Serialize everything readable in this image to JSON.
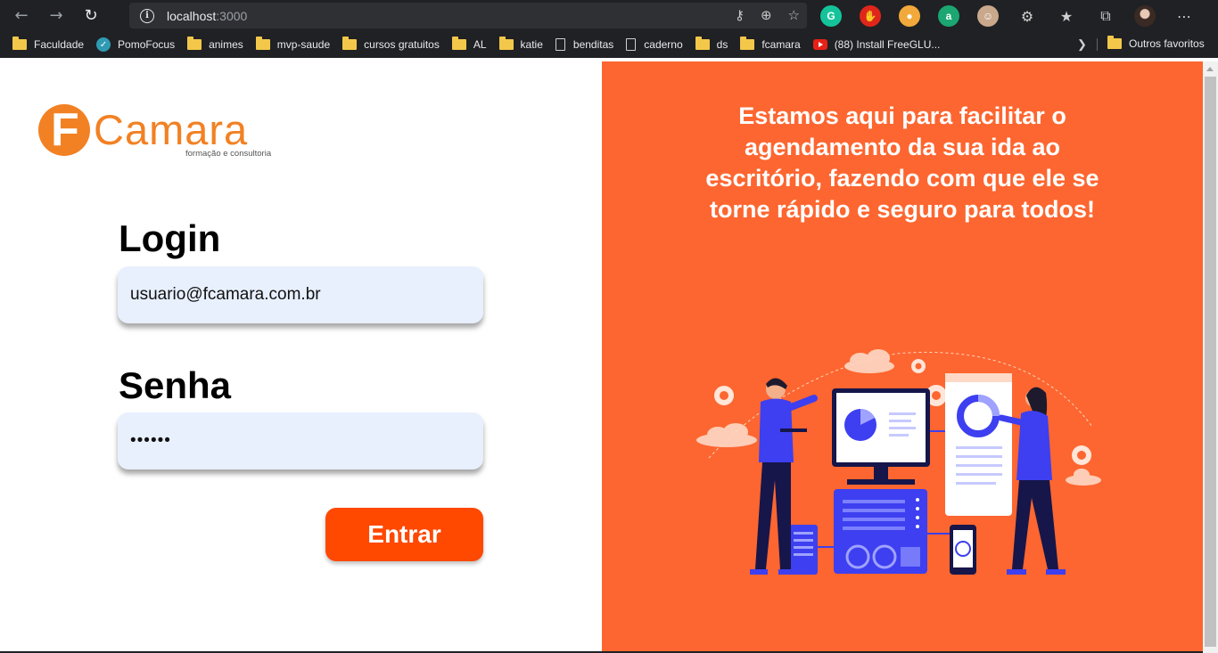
{
  "browser": {
    "url_host": "localhost",
    "url_port": ":3000",
    "extensions": [
      "grammarly-icon",
      "adblock-icon",
      "extension-icon",
      "extension-a-icon",
      "profile-extension-icon"
    ],
    "bookmarks": [
      {
        "label": "Faculdade",
        "icon": "folder"
      },
      {
        "label": "PomoFocus",
        "icon": "check"
      },
      {
        "label": "animes",
        "icon": "folder"
      },
      {
        "label": "mvp-saude",
        "icon": "folder"
      },
      {
        "label": "cursos gratuitos",
        "icon": "folder"
      },
      {
        "label": "AL",
        "icon": "folder"
      },
      {
        "label": "katie",
        "icon": "folder"
      },
      {
        "label": "benditas",
        "icon": "page"
      },
      {
        "label": "caderno",
        "icon": "page"
      },
      {
        "label": "ds",
        "icon": "folder"
      },
      {
        "label": "fcamara",
        "icon": "folder"
      },
      {
        "label": "(88) Install FreeGLU...",
        "icon": "youtube"
      }
    ],
    "other_bookmarks": "Outros favoritos"
  },
  "logo": {
    "initial": "F",
    "word": "Camara",
    "tagline": "formação e consultoria",
    "color": "#f28123"
  },
  "form": {
    "login_label": "Login",
    "email_value": "usuario@fcamara.com.br",
    "password_label": "Senha",
    "password_value": "••••••",
    "submit_label": "Entrar"
  },
  "hero": {
    "tagline": "Estamos aqui para facilitar o agendamento da sua ida ao escritório, fazendo com que ele se torne rápido e seguro para todos!",
    "background": "#fd6630",
    "illustration_icon": "office-team-illustration"
  },
  "colors": {
    "accent": "#ff4800",
    "input_bg": "#e8f0fe",
    "illustration_blue": "#3d3ff0"
  }
}
